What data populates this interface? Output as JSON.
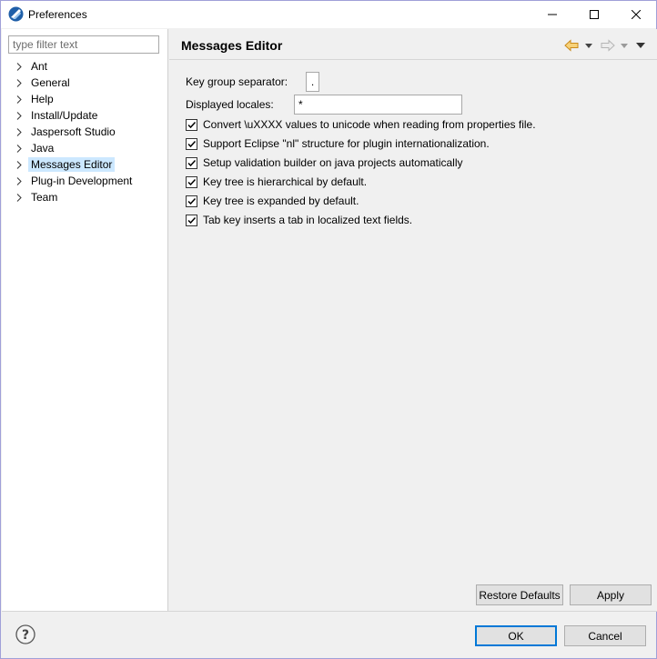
{
  "window": {
    "title": "Preferences",
    "icons": {
      "app": "eclipse-icon",
      "minimize": "minimize-icon",
      "maximize": "maximize-icon",
      "close": "close-icon"
    }
  },
  "sidebar": {
    "filter_placeholder": "type filter text",
    "filter_value": "",
    "items": [
      {
        "label": "Ant",
        "selected": false
      },
      {
        "label": "General",
        "selected": false
      },
      {
        "label": "Help",
        "selected": false
      },
      {
        "label": "Install/Update",
        "selected": false
      },
      {
        "label": "Jaspersoft Studio",
        "selected": false
      },
      {
        "label": "Java",
        "selected": false
      },
      {
        "label": "Messages Editor",
        "selected": true
      },
      {
        "label": "Plug-in Development",
        "selected": false
      },
      {
        "label": "Team",
        "selected": false
      }
    ]
  },
  "page": {
    "title": "Messages Editor",
    "nav": {
      "back_icon": "back-arrow-icon",
      "forward_icon": "forward-arrow-icon",
      "menu_icon": "view-menu-icon"
    },
    "key_group_separator": {
      "label": "Key group separator:",
      "value": "."
    },
    "displayed_locales": {
      "label": "Displayed locales:",
      "value": "*"
    },
    "options": [
      {
        "label": "Convert \\uXXXX values to unicode when reading from properties file.",
        "checked": true
      },
      {
        "label": "Support Eclipse \"nl\" structure for plugin internationalization.",
        "checked": true
      },
      {
        "label": "Setup validation builder on java projects automatically",
        "checked": true
      },
      {
        "label": "Key tree is hierarchical by default.",
        "checked": true
      },
      {
        "label": "Key tree is expanded by default.",
        "checked": true
      },
      {
        "label": "Tab key inserts a tab in localized text fields.",
        "checked": true
      }
    ],
    "restore_defaults_label": "Restore Defaults",
    "apply_label": "Apply"
  },
  "footer": {
    "help_icon": "help-icon",
    "ok_label": "OK",
    "cancel_label": "Cancel"
  },
  "colors": {
    "accent": "#0078d7",
    "selection": "#cce8ff",
    "nav_back_arrow": "#e8a33d"
  }
}
